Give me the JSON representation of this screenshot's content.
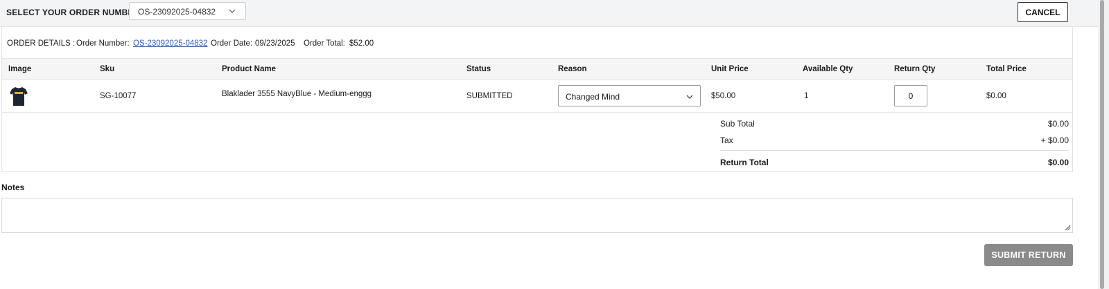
{
  "header": {
    "select_label": "SELECT YOUR ORDER NUMBER",
    "order_select_value": "OS-23092025-04832",
    "cancel_label": "CANCEL"
  },
  "order_details": {
    "label": "ORDER DETAILS :",
    "order_number_label": "Order Number:",
    "order_number": "OS-23092025-04832",
    "order_date_label": "Order Date:",
    "order_date": "09/23/2025",
    "order_total_label": "Order Total:",
    "order_total": "$52.00"
  },
  "table": {
    "columns": [
      "Image",
      "Sku",
      "Product Name",
      "Status",
      "Reason",
      "Unit Price",
      "Available Qty",
      "Return Qty",
      "Total Price"
    ],
    "rows": [
      {
        "image_icon": "tshirt-thumbnail",
        "sku": "SG-10077",
        "product_name": "Blaklader 3555 NavyBlue - Medium-enggg",
        "status": "SUBMITTED",
        "reason": "Changed Mind",
        "unit_price": "$50.00",
        "available_qty": "1",
        "return_qty": "0",
        "total_price": "$0.00"
      }
    ]
  },
  "totals": {
    "subtotal_label": "Sub Total",
    "subtotal": "$0.00",
    "tax_label": "Tax",
    "tax": "+ $0.00",
    "return_total_label": "Return Total",
    "return_total": "$0.00"
  },
  "notes": {
    "label": "Notes",
    "value": ""
  },
  "actions": {
    "submit_label": "SUBMIT RETURN"
  },
  "colors": {
    "link": "#2a5bd7",
    "submit_bg": "#8a8a8a",
    "header_bg": "#f3f4f6"
  }
}
